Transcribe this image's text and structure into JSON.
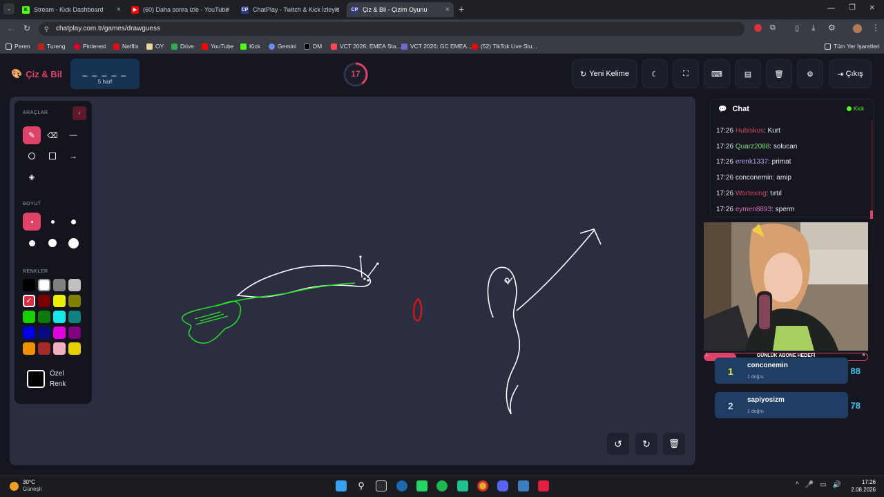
{
  "browser": {
    "tabs": [
      {
        "title": "Stream - Kick Dashboard"
      },
      {
        "title": "(60) Daha sonra izle - YouTube"
      },
      {
        "title": "ChatPlay - Twitch & Kick İzleyic"
      },
      {
        "title": "Çiz & Bil - Çizim Oyunu"
      }
    ],
    "url": "chatplay.com.tr/games/drawguess",
    "bookmarks": [
      "Peren",
      "Tureng",
      "Pinterest",
      "Netflix",
      "OY",
      "Drive",
      "YouTube",
      "Kick",
      "Gemini",
      "DM",
      "VCT 2026: EMEA Sta...",
      "VCT 2026: GC EMEA...",
      "(52) TikTok Live Stu..."
    ],
    "other_bookmarks": "Tüm Yer İşaretleri"
  },
  "app": {
    "title": "Çiz & Bil",
    "word_mask": "_ _ _ _ _",
    "word_hint": "5 harf",
    "timer": "17",
    "timer_fraction": 0.4,
    "buttons": {
      "new_word": "Yeni Kelime",
      "exit": "Çıkış"
    }
  },
  "toolbox": {
    "tools_title": "ARAÇLAR",
    "size_title": "BOYUT",
    "colors_title": "RENKLER",
    "custom_color_label1": "Özel",
    "custom_color_label2": "Renk",
    "palette": [
      "#000000",
      "#ffffff",
      "#808080",
      "#c0c0c0",
      "#e03040",
      "#7a0000",
      "#e8f000",
      "#808000",
      "#19d000",
      "#0a7a0a",
      "#14e8e8",
      "#108080",
      "#0000e0",
      "#0a0a80",
      "#e000e0",
      "#800080",
      "#f09000",
      "#a52a2a",
      "#f0b0c0",
      "#e8d000"
    ],
    "selected_color": "#e03040",
    "accent": "#e0436a"
  },
  "chat": {
    "title": "Chat",
    "platform": "Kick",
    "messages": [
      {
        "time": "17:26",
        "user": "Hubiskus",
        "text": ": Kurt",
        "color": "#d0475f"
      },
      {
        "time": "17:26",
        "user": "Quarz2088",
        "text": ": solucan",
        "color": "#7ee07e"
      },
      {
        "time": "17:26",
        "user": "erenk1337",
        "text": ": primat",
        "color": "#b79ee8"
      },
      {
        "time": "17:26",
        "user": "conconemin",
        "text": ": amip",
        "color": "#e7e9ef"
      },
      {
        "time": "17:26",
        "user": "Wortexing",
        "text": ": tırtıl",
        "color": "#d0475f"
      },
      {
        "time": "17:26",
        "user": "eymen8893",
        "text": ": sperm",
        "color": "#d36fb2"
      }
    ]
  },
  "overlay": {
    "goal_label": "GÜNLÜK ABONE HEDEFİ",
    "goal_current": "1",
    "goal_target": "6"
  },
  "leaderboard": [
    {
      "rank": "1",
      "name": "conconemin",
      "sub": "1 doğru",
      "score": "88"
    },
    {
      "rank": "2",
      "name": "sapiyosizm",
      "sub": "1 doğru",
      "score": "78"
    }
  ],
  "taskbar": {
    "temperature": "30°C",
    "weather": "Güneşli",
    "time": "17:26",
    "date": "2.08.2026"
  }
}
